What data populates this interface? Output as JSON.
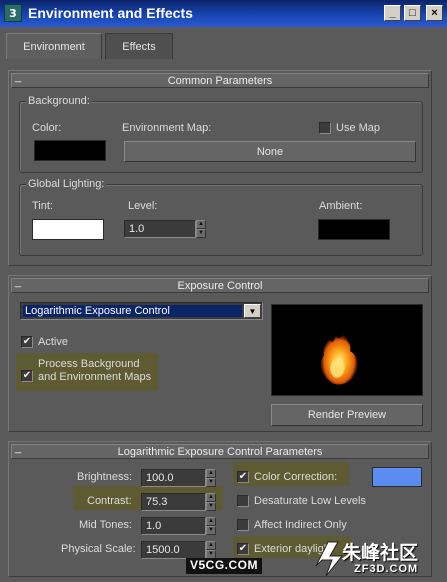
{
  "window": {
    "title": "Environment and Effects",
    "app_icon": "3ds-max-icon",
    "controls": [
      "_",
      "□",
      "×"
    ]
  },
  "tabs": [
    {
      "label": "Environment",
      "active": true
    },
    {
      "label": "Effects",
      "active": false
    }
  ],
  "common": {
    "header": "Common Parameters",
    "background": {
      "group_label": "Background:",
      "color_label": "Color:",
      "color": "#000000",
      "env_map_label": "Environment Map:",
      "use_map_label": "Use Map",
      "use_map_checked": false,
      "env_map_button": "None"
    },
    "lighting": {
      "group_label": "Global Lighting:",
      "tint_label": "Tint:",
      "tint_color": "#ffffff",
      "level_label": "Level:",
      "level_value": "1.0",
      "ambient_label": "Ambient:",
      "ambient_color": "#000000"
    }
  },
  "exposure": {
    "header": "Exposure Control",
    "dropdown_value": "Logarithmic Exposure Control",
    "active_label": "Active",
    "active_checked": true,
    "process_bg_label_1": "Process Background",
    "process_bg_label_2": "and Environment Maps",
    "process_bg_checked": true,
    "render_preview_label": "Render Preview"
  },
  "log_params": {
    "header": "Logarithmic Exposure Control Parameters",
    "brightness_label": "Brightness:",
    "brightness_value": "100.0",
    "contrast_label": "Contrast:",
    "contrast_value": "75.3",
    "midtones_label": "Mid Tones:",
    "midtones_value": "1.0",
    "physical_scale_label": "Physical Scale:",
    "physical_scale_value": "1500.0",
    "color_correction_label": "Color Correction:",
    "color_correction_checked": true,
    "color_correction_color": "#5b8cf0",
    "desaturate_label": "Desaturate Low Levels",
    "desaturate_checked": false,
    "affect_indirect_label": "Affect Indirect Only",
    "affect_indirect_checked": false,
    "exterior_daylight_label": "Exterior daylight",
    "exterior_daylight_checked": true
  },
  "watermarks": {
    "left": "V5CG.COM",
    "right_cn": "朱峰社区",
    "right_en": "ZF3D.COM"
  },
  "colors": {
    "highlight": "#5e5a32",
    "title_bar": "#1a48b8"
  }
}
